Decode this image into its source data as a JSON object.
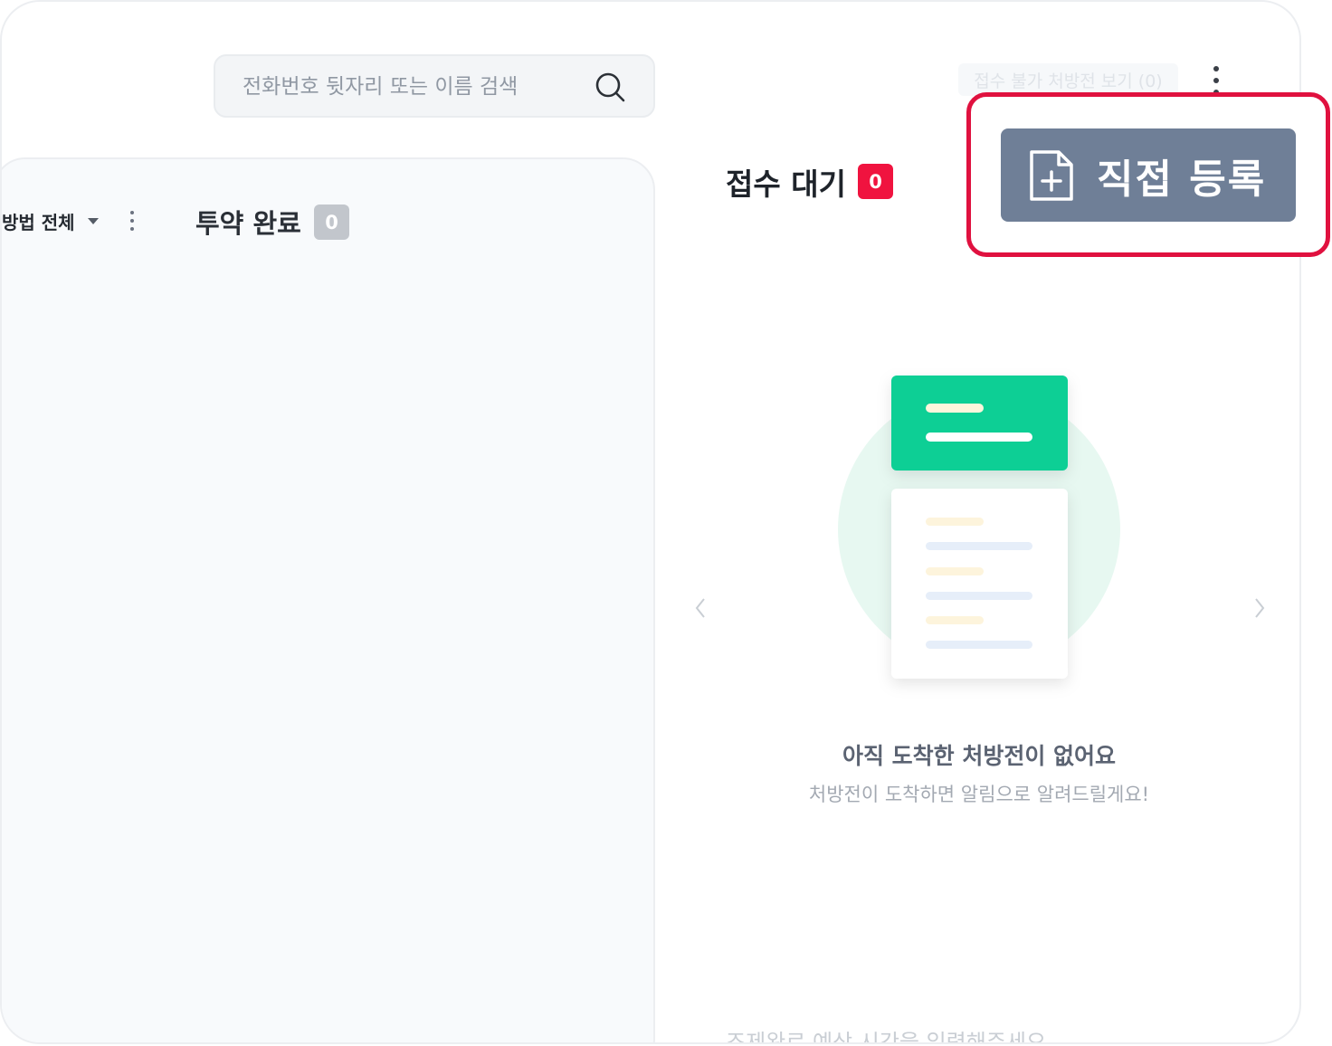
{
  "search": {
    "placeholder": "전화번호 뒷자리 또는 이름 검색"
  },
  "left_panel": {
    "filter_label": "방법 전체",
    "title": "투약 완료",
    "count": "0"
  },
  "right_panel": {
    "title": "접수 대기",
    "count": "0",
    "blocked_link": "접수 불가 처방전 보기 (0)",
    "direct_register_label": "직접 등록",
    "empty_title": "아직 도착한 처방전이 없어요",
    "empty_subtitle": "처방전이 도착하면 알림으로 알려드릴게요!",
    "bottom_hint": "조제완료 예상 시간을 입력해주세요"
  },
  "colors": {
    "accent_red": "#f0133f",
    "button_gray": "#6f7f97",
    "illustration_green": "#08cf95"
  },
  "icons": [
    "search-icon",
    "kebab-menu-icon",
    "document-add-icon",
    "chevron-left-icon",
    "chevron-right-icon"
  ]
}
